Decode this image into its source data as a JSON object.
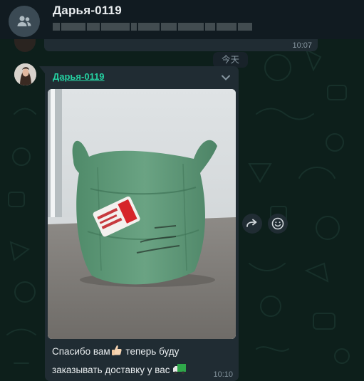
{
  "header": {
    "title": "Дарья-0119",
    "subtitle_redacted": true,
    "avatar_icon": "group-icon"
  },
  "previous_message": {
    "time": "10:07"
  },
  "date_chip": "今天",
  "message": {
    "sender": "Дарья-0119",
    "sender_color": "#25d0a1",
    "caption_line1": "Спасибо вам",
    "caption_line1_rest": " теперь буду",
    "caption_line2": "заказывать доставку у вас ",
    "emoji_1": "thumbs-up-icon",
    "emoji_2": "delivery-truck-icon",
    "time": "10:10",
    "photo_alt": "green woven sack package"
  },
  "actions": {
    "forward_icon": "forward-icon",
    "react_icon": "emoji-icon"
  },
  "colors": {
    "header_bg": "#111b21",
    "bubble_bg": "#202c33",
    "wallpaper_bg": "#0d1f1b",
    "meta_text": "#8696a0"
  }
}
